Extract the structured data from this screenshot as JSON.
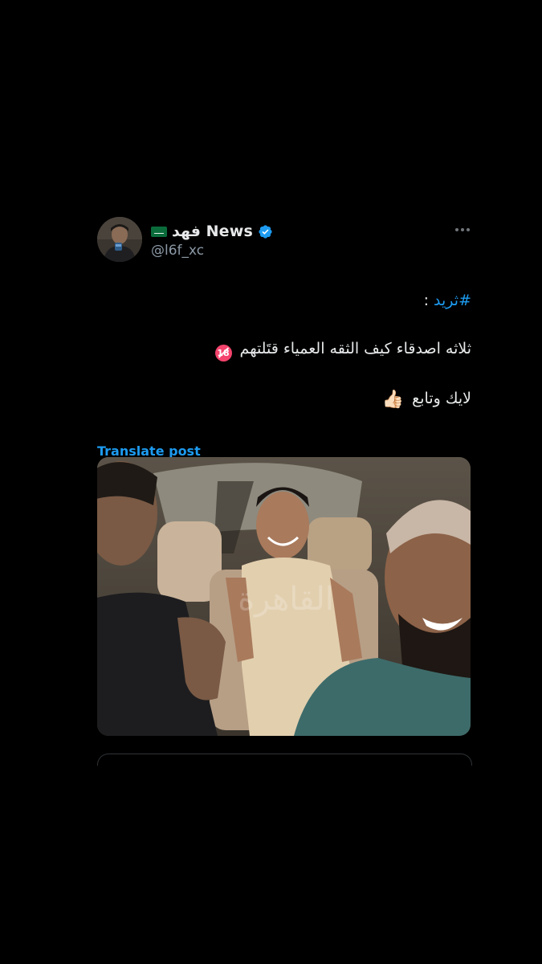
{
  "author": {
    "display_name": "فهد News",
    "handle": "@l6f_xc",
    "verified": true,
    "flag_icon": "saudi-flag-icon",
    "avatar_icon": "avatar-photo"
  },
  "post": {
    "hashtag": "#ثريد",
    "hashtag_suffix": " :",
    "line2": "ثلاثه اصدقاء كيف الثقه العمياء قتَلتهم",
    "line2_emoji": "18",
    "line3": "لايك وتابع",
    "line3_emoji": "👍🏻"
  },
  "translate_label": "Translate post",
  "media": {
    "watermark": "القاهرة",
    "type": "photo"
  },
  "colors": {
    "background": "#000000",
    "text": "#e7e9ea",
    "secondary": "#8b98a5",
    "accent": "#1d9bf0"
  }
}
